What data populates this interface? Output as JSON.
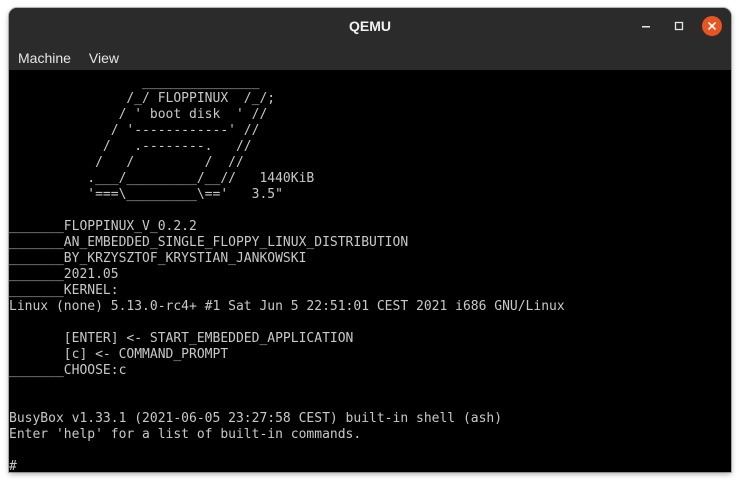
{
  "window": {
    "title": "QEMU"
  },
  "menu": {
    "items": [
      "Machine",
      "View"
    ]
  },
  "console": {
    "lines": [
      "                 _______________",
      "               /_/ FLOPPINUX  /_/;",
      "              / ' boot disk  ' //",
      "             / '------------' //",
      "            /   .--------.   //",
      "           /   /         /  //",
      "          .___/_________/__//   1440KiB",
      "          '===\\_________\\=='   3.5\"",
      "",
      "_______FLOPPINUX_V_0.2.2",
      "_______AN_EMBEDDED_SINGLE_FLOPPY_LINUX_DISTRIBUTION",
      "_______BY_KRZYSZTOF_KRYSTIAN_JANKOWSKI",
      "_______2021.05",
      "_______KERNEL:",
      "Linux (none) 5.13.0-rc4+ #1 Sat Jun 5 22:51:01 CEST 2021 i686 GNU/Linux",
      "",
      "       [ENTER] <- START_EMBEDDED_APPLICATION",
      "       [c] <- COMMAND_PROMPT",
      "_______CHOOSE:c",
      "",
      "",
      "BusyBox v1.33.1 (2021-06-05 23:27:58 CEST) built-in shell (ash)",
      "Enter 'help' for a list of built-in commands.",
      "",
      "# _"
    ]
  },
  "colors": {
    "titlebar": "#2b2b2b",
    "console_text": "#c8c8c8",
    "close_button": "#e95420"
  }
}
